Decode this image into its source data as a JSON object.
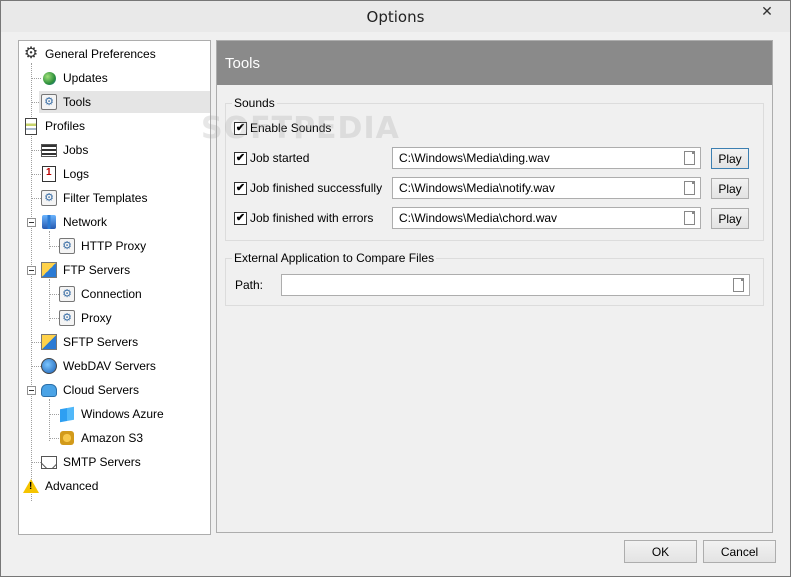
{
  "window": {
    "title": "Options",
    "close_glyph": "✕"
  },
  "tree": [
    {
      "label": "General Preferences",
      "icon": "gear-icon"
    },
    {
      "label": "Updates",
      "icon": "globe-icon"
    },
    {
      "label": "Tools",
      "icon": "cog-page-icon"
    },
    {
      "label": "Profiles",
      "icon": "profile-icon"
    },
    {
      "label": "Jobs",
      "icon": "jobs-icon"
    },
    {
      "label": "Logs",
      "icon": "logs-icon"
    },
    {
      "label": "Filter Templates",
      "icon": "cog-page-icon"
    },
    {
      "label": "Network",
      "icon": "network-icon"
    },
    {
      "label": "HTTP Proxy",
      "icon": "cog-page-icon"
    },
    {
      "label": "FTP Servers",
      "icon": "ftp-icon"
    },
    {
      "label": "Connection",
      "icon": "cog-page-icon"
    },
    {
      "label": "Proxy",
      "icon": "cog-page-icon"
    },
    {
      "label": "SFTP Servers",
      "icon": "sftp-icon"
    },
    {
      "label": "WebDAV Servers",
      "icon": "webdav-icon"
    },
    {
      "label": "Cloud Servers",
      "icon": "cloud-icon"
    },
    {
      "label": "Windows Azure",
      "icon": "azure-icon"
    },
    {
      "label": "Amazon S3",
      "icon": "s3-icon"
    },
    {
      "label": "SMTP Servers",
      "icon": "mail-icon"
    },
    {
      "label": "Advanced",
      "icon": "warning-icon"
    }
  ],
  "selected_item": "Tools",
  "panel": {
    "header": "Tools",
    "sounds": {
      "title": "Sounds",
      "enable_label": "Enable Sounds",
      "enable_checked": true,
      "rows": [
        {
          "label": "Job started",
          "checked": true,
          "path": "C:\\Windows\\Media\\ding.wav",
          "play": "Play"
        },
        {
          "label": "Job finished successfully",
          "checked": true,
          "path": "C:\\Windows\\Media\\notify.wav",
          "play": "Play"
        },
        {
          "label": "Job finished with errors",
          "checked": true,
          "path": "C:\\Windows\\Media\\chord.wav",
          "play": "Play"
        }
      ]
    },
    "external": {
      "title": "External Application to Compare Files",
      "path_label": "Path:",
      "path_value": ""
    }
  },
  "buttons": {
    "ok": "OK",
    "cancel": "Cancel"
  },
  "check_glyph": "✔",
  "watermark": "SOFTPEDIA"
}
